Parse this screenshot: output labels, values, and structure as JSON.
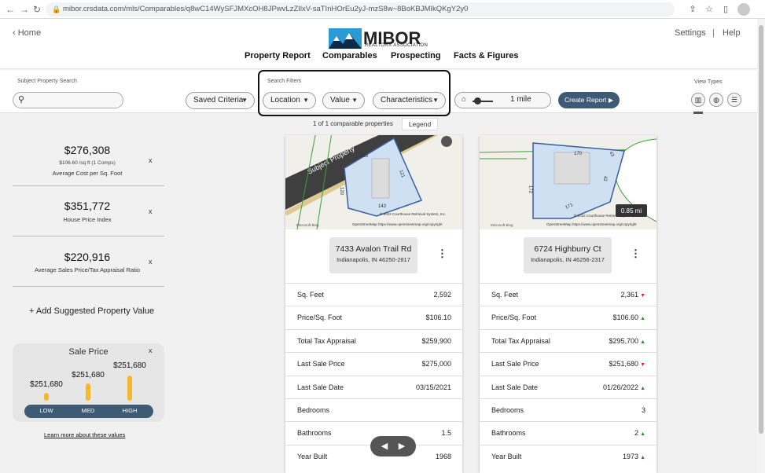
{
  "browser": {
    "url": "mibor.crsdata.com/mls/Comparables/q8wC14WySFJMXcOH8JPwvLzZIlxV-saTInHOrEu2yJ-mzS8w~8BoKBJMIkQKgY2y0"
  },
  "header": {
    "home_label": "Home",
    "logo_text": "MIBOR",
    "logo_sub": "REALTOR® ASSOCIATION",
    "settings_label": "Settings",
    "separator": "|",
    "help_label": "Help",
    "nav": [
      "Property Report",
      "Comparables",
      "Prospecting",
      "Facts & Figures"
    ]
  },
  "filters": {
    "search_label": "Subject Property Search",
    "search_placeholder": "",
    "saved_criteria": "Saved Criteria",
    "filters_label": "Search Filters",
    "location": "Location",
    "value": "Value",
    "characteristics": "Characteristics",
    "radius": "1 mile",
    "create_report": "Create Report",
    "view_types_label": "View Types"
  },
  "results": {
    "count_text": "1 of 1 comparable properties",
    "legend_label": "Legend"
  },
  "sidebar": {
    "stats": [
      {
        "value": "$276,308",
        "sub": "$106.60 /sq ft (1 Comps)",
        "label": "Average Cost per Sq. Foot",
        "close": "x"
      },
      {
        "value": "$351,772",
        "sub": "",
        "label": "House Price Index",
        "close": "x"
      },
      {
        "value": "$220,916",
        "sub": "",
        "label": "Average Sales Price/Tax Appraisal Ratio",
        "close": "x"
      }
    ],
    "add_value": "+  Add Suggested Property Value",
    "sale_price": {
      "title": "Sale Price",
      "close": "x",
      "bars": [
        {
          "label": "LOW",
          "value": "$251,680",
          "level": 0.25
        },
        {
          "label": "MED",
          "value": "$251,680",
          "level": 0.55
        },
        {
          "label": "HIGH",
          "value": "$251,680",
          "level": 0.8
        }
      ]
    },
    "learn_more": "Learn more about these values"
  },
  "cards": [
    {
      "street": "7433 Avalon Trail Rd",
      "city": "Indianapolis, IN 46250-2817",
      "map_labels": [
        "Subject Property",
        "128",
        "121",
        "120",
        "143",
        "© 2022 Courthouse Retrieval System, Inc.",
        "OpenStreetMap https://www.openstreetmap.org/copyright",
        "Microsoft Bing"
      ],
      "rows": [
        {
          "label": "Sq. Feet",
          "value": "2,592",
          "trend": ""
        },
        {
          "label": "Price/Sq. Foot",
          "value": "$106.10",
          "trend": ""
        },
        {
          "label": "Total Tax Appraisal",
          "value": "$259,900",
          "trend": ""
        },
        {
          "label": "Last Sale Price",
          "value": "$275,000",
          "trend": ""
        },
        {
          "label": "Last Sale Date",
          "value": "03/15/2021",
          "trend": ""
        },
        {
          "label": "Bedrooms",
          "value": "",
          "trend": ""
        },
        {
          "label": "Bathrooms",
          "value": "1.5",
          "trend": ""
        },
        {
          "label": "Year Built",
          "value": "1968",
          "trend": ""
        }
      ]
    },
    {
      "street": "6724 Highburry Ct",
      "city": "Indianapolis, IN 46256-2317",
      "distance": "0.85 mi",
      "map_labels": [
        "170",
        "43",
        "172",
        "42",
        "171",
        "© 2022 Courthouse Retrieval System, Inc.",
        "OpenStreetMap https://www.openstreetmap.org/copyright",
        "Microsoft Bing"
      ],
      "rows": [
        {
          "label": "Sq. Feet",
          "value": "2,361",
          "trend": "down"
        },
        {
          "label": "Price/Sq. Foot",
          "value": "$106.60",
          "trend": "up"
        },
        {
          "label": "Total Tax Appraisal",
          "value": "$295,700",
          "trend": "up"
        },
        {
          "label": "Last Sale Price",
          "value": "$251,680",
          "trend": "down"
        },
        {
          "label": "Last Sale Date",
          "value": "01/26/2022",
          "trend": "up"
        },
        {
          "label": "Bedrooms",
          "value": "3",
          "trend": ""
        },
        {
          "label": "Bathrooms",
          "value": "2",
          "trend": "up"
        },
        {
          "label": "Year Built",
          "value": "1973",
          "trend": "up"
        }
      ]
    }
  ],
  "colors": {
    "accent": "#3d5b74",
    "bar": "#f5b82e",
    "trend_up": "#2a8a2a",
    "trend_down": "#d22222"
  }
}
